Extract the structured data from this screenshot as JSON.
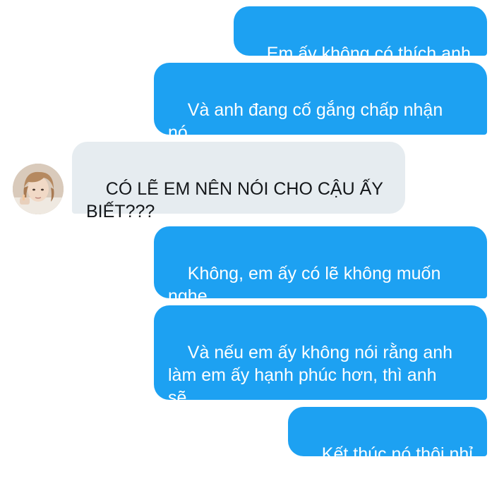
{
  "conversation": {
    "messages": [
      {
        "sender": "me",
        "text": "Em ấy không có thích anh"
      },
      {
        "sender": "me",
        "text": "Và anh đang cố gắng chấp nhận\nnó"
      },
      {
        "sender": "other",
        "text": "CÓ LẼ EM NÊN NÓI CHO CẬU ẤY\nBIẾT???"
      },
      {
        "sender": "me",
        "text": "Không, em ấy có lẽ không muốn\nnghe"
      },
      {
        "sender": "me",
        "text": "Và nếu em ấy không nói rằng anh\nlàm em ấy hạnh phúc hơn, thì anh\nsẽ"
      },
      {
        "sender": "me",
        "text": "Kết thúc nó thôi nhỉ"
      }
    ]
  },
  "colors": {
    "sent_bubble": "#1da1f2",
    "received_bubble": "#e6ecf0",
    "background": "#ffffff"
  },
  "icons": {
    "avatar": "avatar-photo"
  }
}
